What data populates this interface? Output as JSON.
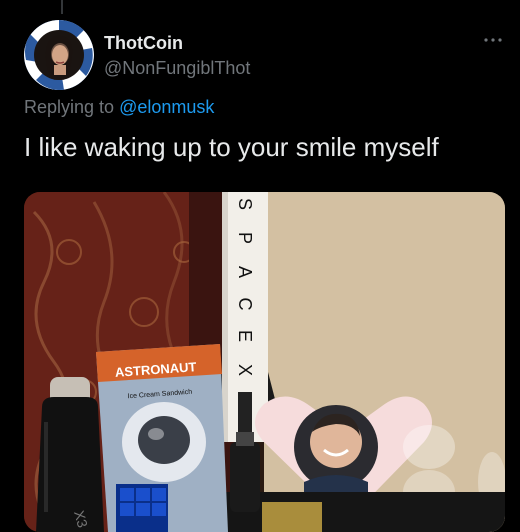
{
  "tweet": {
    "display_name": "ThotCoin",
    "handle": "@NonFungiblThot",
    "replying_prefix": "Replying to",
    "replying_to": "@elonmusk",
    "text": "I like waking up to your smile myself"
  },
  "media": {
    "rocket_letters": [
      "S",
      "P",
      "A",
      "C",
      "E",
      "X"
    ],
    "package_brand": "ASTRONAUT",
    "package_product": "Ice Cream Sandwich"
  },
  "icons": {
    "more": "more-horizontal-icon"
  },
  "colors": {
    "background": "#000000",
    "text_primary": "#e7e9ea",
    "text_secondary": "#71767b",
    "link": "#1d9bf0"
  }
}
